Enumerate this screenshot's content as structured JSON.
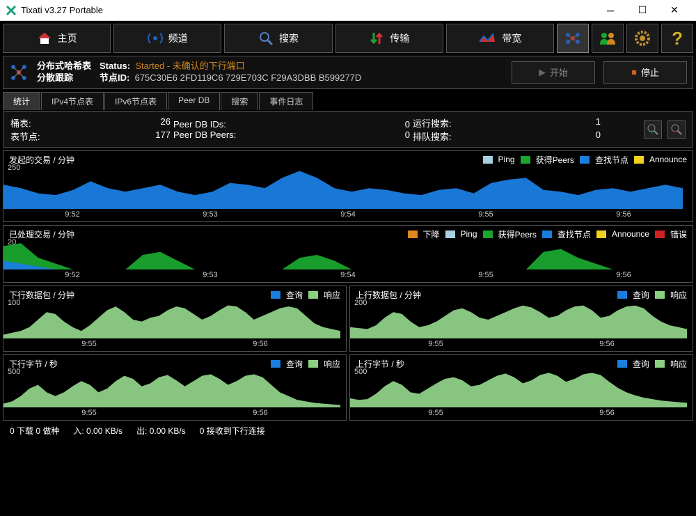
{
  "window": {
    "title": "Tixati v3.27 Portable"
  },
  "toolbar": {
    "home": "主页",
    "channels": "频道",
    "search": "搜索",
    "transfers": "传输",
    "bandwidth": "带宽"
  },
  "dht": {
    "title1": "分布式哈希表",
    "title2": "分散跟踪",
    "status_label": "Status:",
    "status_val": "Started - 未确认的下行端口",
    "nodeid_label": "节点ID:",
    "nodeid_val": "675C30E6 2FD119C6 729E703C F29A3DBB B599277D",
    "start": "开始",
    "stop": "停止"
  },
  "tabs": [
    "统计",
    "IPv4节点表",
    "IPv6节点表",
    "Peer DB",
    "搜索",
    "事件日志"
  ],
  "stats": {
    "buckets_label": "桶表:",
    "buckets_val": "26",
    "tnodes_label": "表节点:",
    "tnodes_val": "177",
    "pdbids_label": "Peer DB IDs:",
    "pdbids_val": "0",
    "pdbpeers_label": "Peer DB Peers:",
    "pdbpeers_val": "0",
    "rsearch_label": "运行搜索:",
    "rsearch_val": "1",
    "qsearch_label": "排队搜索:",
    "qsearch_val": "0"
  },
  "legends": {
    "ping": "Ping",
    "getpeers": "获得Peers",
    "findnode": "查找节点",
    "announce": "Announce",
    "down": "下降",
    "error": "错误",
    "query": "查询",
    "response": "响应"
  },
  "colors": {
    "ping": "#a7d0e0",
    "getpeers": "#1aa52e",
    "findnode": "#1a7de0",
    "announce": "#f0d020",
    "down": "#e08820",
    "error": "#d02020",
    "query": "#1a7de0",
    "response": "#8ad080",
    "area_green": "#8ed088"
  },
  "chart_data": [
    {
      "title": "发起的交易 / 分钟",
      "type": "area",
      "ylim": [
        0,
        250
      ],
      "ylabel": "250",
      "xticks": [
        "9:52",
        "9:53",
        "9:54",
        "9:55",
        "9:56"
      ],
      "legend": [
        "Ping",
        "获得Peers",
        "查找节点",
        "Announce"
      ],
      "series": [
        {
          "name": "查找节点",
          "color": "#1a7de0",
          "values": [
            140,
            120,
            90,
            80,
            110,
            160,
            120,
            100,
            120,
            140,
            100,
            80,
            100,
            150,
            140,
            120,
            180,
            220,
            180,
            120,
            100,
            120,
            110,
            90,
            80,
            110,
            120,
            90,
            150,
            170,
            180,
            110,
            100,
            80,
            110,
            120,
            100,
            120,
            140,
            120
          ]
        }
      ]
    },
    {
      "title": "已处理交易 / 分钟",
      "type": "area",
      "ylim": [
        0,
        20
      ],
      "ylabel": "20",
      "xticks": [
        "9:52",
        "9:53",
        "9:54",
        "9:55",
        "9:56"
      ],
      "legend": [
        "下降",
        "Ping",
        "获得Peers",
        "查找节点",
        "Announce",
        "错误"
      ],
      "series": [
        {
          "name": "获得Peers",
          "color": "#1aa52e",
          "values": [
            16,
            18,
            8,
            4,
            0,
            0,
            0,
            0,
            10,
            12,
            6,
            0,
            0,
            0,
            0,
            0,
            0,
            8,
            10,
            6,
            0,
            0,
            0,
            0,
            0,
            0,
            0,
            0,
            0,
            0,
            0,
            12,
            14,
            8,
            4,
            0,
            0,
            0,
            0,
            0
          ]
        },
        {
          "name": "查找节点",
          "color": "#1a7de0",
          "values": [
            6,
            4,
            2,
            0,
            0,
            0,
            0,
            0,
            0,
            0,
            0,
            0,
            0,
            0,
            0,
            0,
            0,
            0,
            0,
            0,
            0,
            0,
            0,
            0,
            0,
            0,
            0,
            0,
            0,
            0,
            0,
            0,
            0,
            0,
            0,
            0,
            0,
            0,
            0,
            0
          ]
        }
      ]
    },
    {
      "title": "下行数据包 / 分钟",
      "type": "area",
      "ylim": [
        0,
        100
      ],
      "ylabel": "100",
      "xticks": [
        "9:55",
        "9:56"
      ],
      "legend": [
        "查询",
        "响应"
      ],
      "series": [
        {
          "name": "响应",
          "color": "#8ed088",
          "values": [
            10,
            15,
            20,
            30,
            50,
            70,
            65,
            45,
            30,
            20,
            35,
            55,
            75,
            85,
            70,
            50,
            45,
            55,
            60,
            75,
            85,
            80,
            65,
            50,
            60,
            75,
            88,
            85,
            70,
            50,
            60,
            70,
            80,
            85,
            80,
            60,
            40,
            30,
            25,
            20
          ]
        }
      ]
    },
    {
      "title": "上行数据包 / 分钟",
      "type": "area",
      "ylim": [
        0,
        200
      ],
      "ylabel": "200",
      "xticks": [
        "9:55",
        "9:56"
      ],
      "legend": [
        "查询",
        "响应"
      ],
      "series": [
        {
          "name": "查询",
          "color": "#8ed088",
          "values": [
            60,
            55,
            50,
            70,
            110,
            140,
            130,
            90,
            60,
            70,
            90,
            120,
            150,
            160,
            140,
            110,
            100,
            120,
            140,
            160,
            175,
            165,
            140,
            110,
            120,
            150,
            170,
            175,
            150,
            110,
            120,
            150,
            170,
            175,
            160,
            120,
            90,
            70,
            60,
            50
          ]
        }
      ]
    },
    {
      "title": "下行字节 / 秒",
      "type": "area",
      "ylim": [
        0,
        500
      ],
      "ylabel": "500",
      "xticks": [
        "9:55",
        "9:56"
      ],
      "legend": [
        "查询",
        "响应"
      ],
      "series": [
        {
          "name": "响应",
          "color": "#8ed088",
          "values": [
            50,
            80,
            150,
            250,
            300,
            200,
            150,
            200,
            280,
            350,
            300,
            200,
            250,
            350,
            420,
            380,
            280,
            320,
            400,
            430,
            360,
            280,
            350,
            420,
            440,
            380,
            300,
            350,
            420,
            440,
            400,
            300,
            200,
            150,
            100,
            80,
            60,
            50,
            40,
            30
          ]
        }
      ]
    },
    {
      "title": "上行字节 / 秒",
      "type": "area",
      "ylim": [
        0,
        500
      ],
      "ylabel": "500",
      "xticks": [
        "9:55",
        "9:56"
      ],
      "legend": [
        "查询",
        "响应"
      ],
      "series": [
        {
          "name": "查询",
          "color": "#8ed088",
          "values": [
            120,
            100,
            110,
            180,
            280,
            350,
            300,
            200,
            180,
            250,
            320,
            380,
            400,
            360,
            280,
            300,
            360,
            420,
            450,
            400,
            320,
            360,
            430,
            460,
            420,
            340,
            380,
            440,
            460,
            430,
            340,
            260,
            200,
            160,
            130,
            110,
            90,
            80,
            70,
            60
          ]
        }
      ]
    }
  ],
  "statusbar": {
    "dl": "0 下载  0 做种",
    "in": "入: 0.00 KB/s",
    "out": "出: 0.00 KB/s",
    "conn": "0 接收到下行连接"
  }
}
